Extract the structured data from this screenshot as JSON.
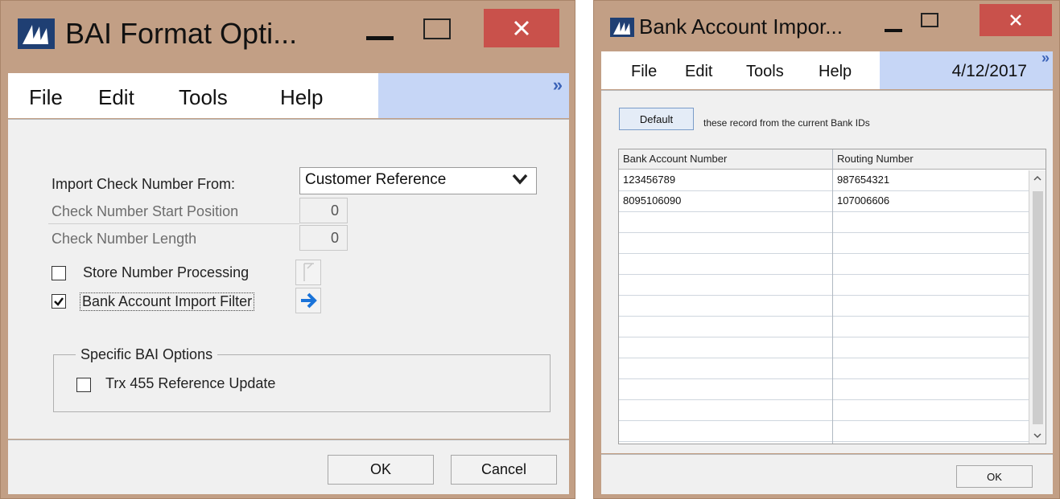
{
  "window1": {
    "title": "BAI Format Opti...",
    "menu": [
      "File",
      "Edit",
      "Tools",
      "Help"
    ],
    "chevron": "»",
    "import_label": "Import Check Number From:",
    "import_value": "Customer Reference",
    "start_label": "Check Number Start Position",
    "start_value": "0",
    "length_label": "Check Number Length",
    "length_value": "0",
    "store_label": "Store Number Processing",
    "store_checked": false,
    "bank_filter_label": "Bank Account Import Filter",
    "bank_filter_checked": true,
    "group_label": "Specific BAI Options",
    "trx_label": "Trx 455 Reference Update",
    "trx_checked": false,
    "ok_label": "OK",
    "cancel_label": "Cancel"
  },
  "window2": {
    "title": "Bank Account Impor...",
    "menu": [
      "File",
      "Edit",
      "Tools",
      "Help"
    ],
    "date": "4/12/2017",
    "chevron": "»",
    "default_label": "Default",
    "default_desc": "these record from the current Bank IDs",
    "columns": [
      "Bank Account Number",
      "Routing Number"
    ],
    "rows": [
      [
        "123456789",
        "987654321"
      ],
      [
        "8095106090",
        "107006606"
      ]
    ],
    "ok_label": "OK"
  },
  "colors": {
    "frame": "#c29f85",
    "close": "#c9514b",
    "menu_accent": "#c6d6f6",
    "arrow_blue": "#1a73d9"
  },
  "icons": [
    "app-logo-icon",
    "minimize-icon",
    "maximize-icon",
    "close-icon",
    "dropdown-chevron-icon",
    "checkmark-icon",
    "lookup-icon",
    "go-arrow-icon",
    "scroll-up-icon",
    "scroll-down-icon"
  ]
}
